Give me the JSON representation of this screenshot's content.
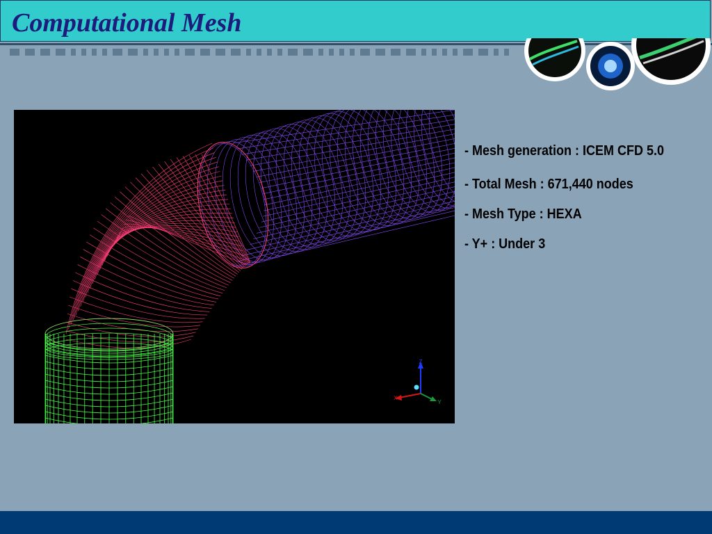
{
  "slide": {
    "title": "Computational Mesh"
  },
  "info": {
    "lines": [
      "- Mesh generation : ICEM CFD 5.0",
      "- Total Mesh : 671,440 nodes",
      "- Mesh Type : HEXA",
      "- Y+ : Under 3"
    ]
  },
  "figure": {
    "axis_labels": {
      "z": "Z",
      "x": "X",
      "y": "Y"
    }
  },
  "colors": {
    "title_bar": "#33cccc",
    "title_text": "#1c1c7c",
    "background": "#8ba3b6",
    "footer": "#003a75",
    "mesh_green": "#4cff4c",
    "mesh_pink": "#ff3f78",
    "mesh_violet": "#8a4dff"
  }
}
